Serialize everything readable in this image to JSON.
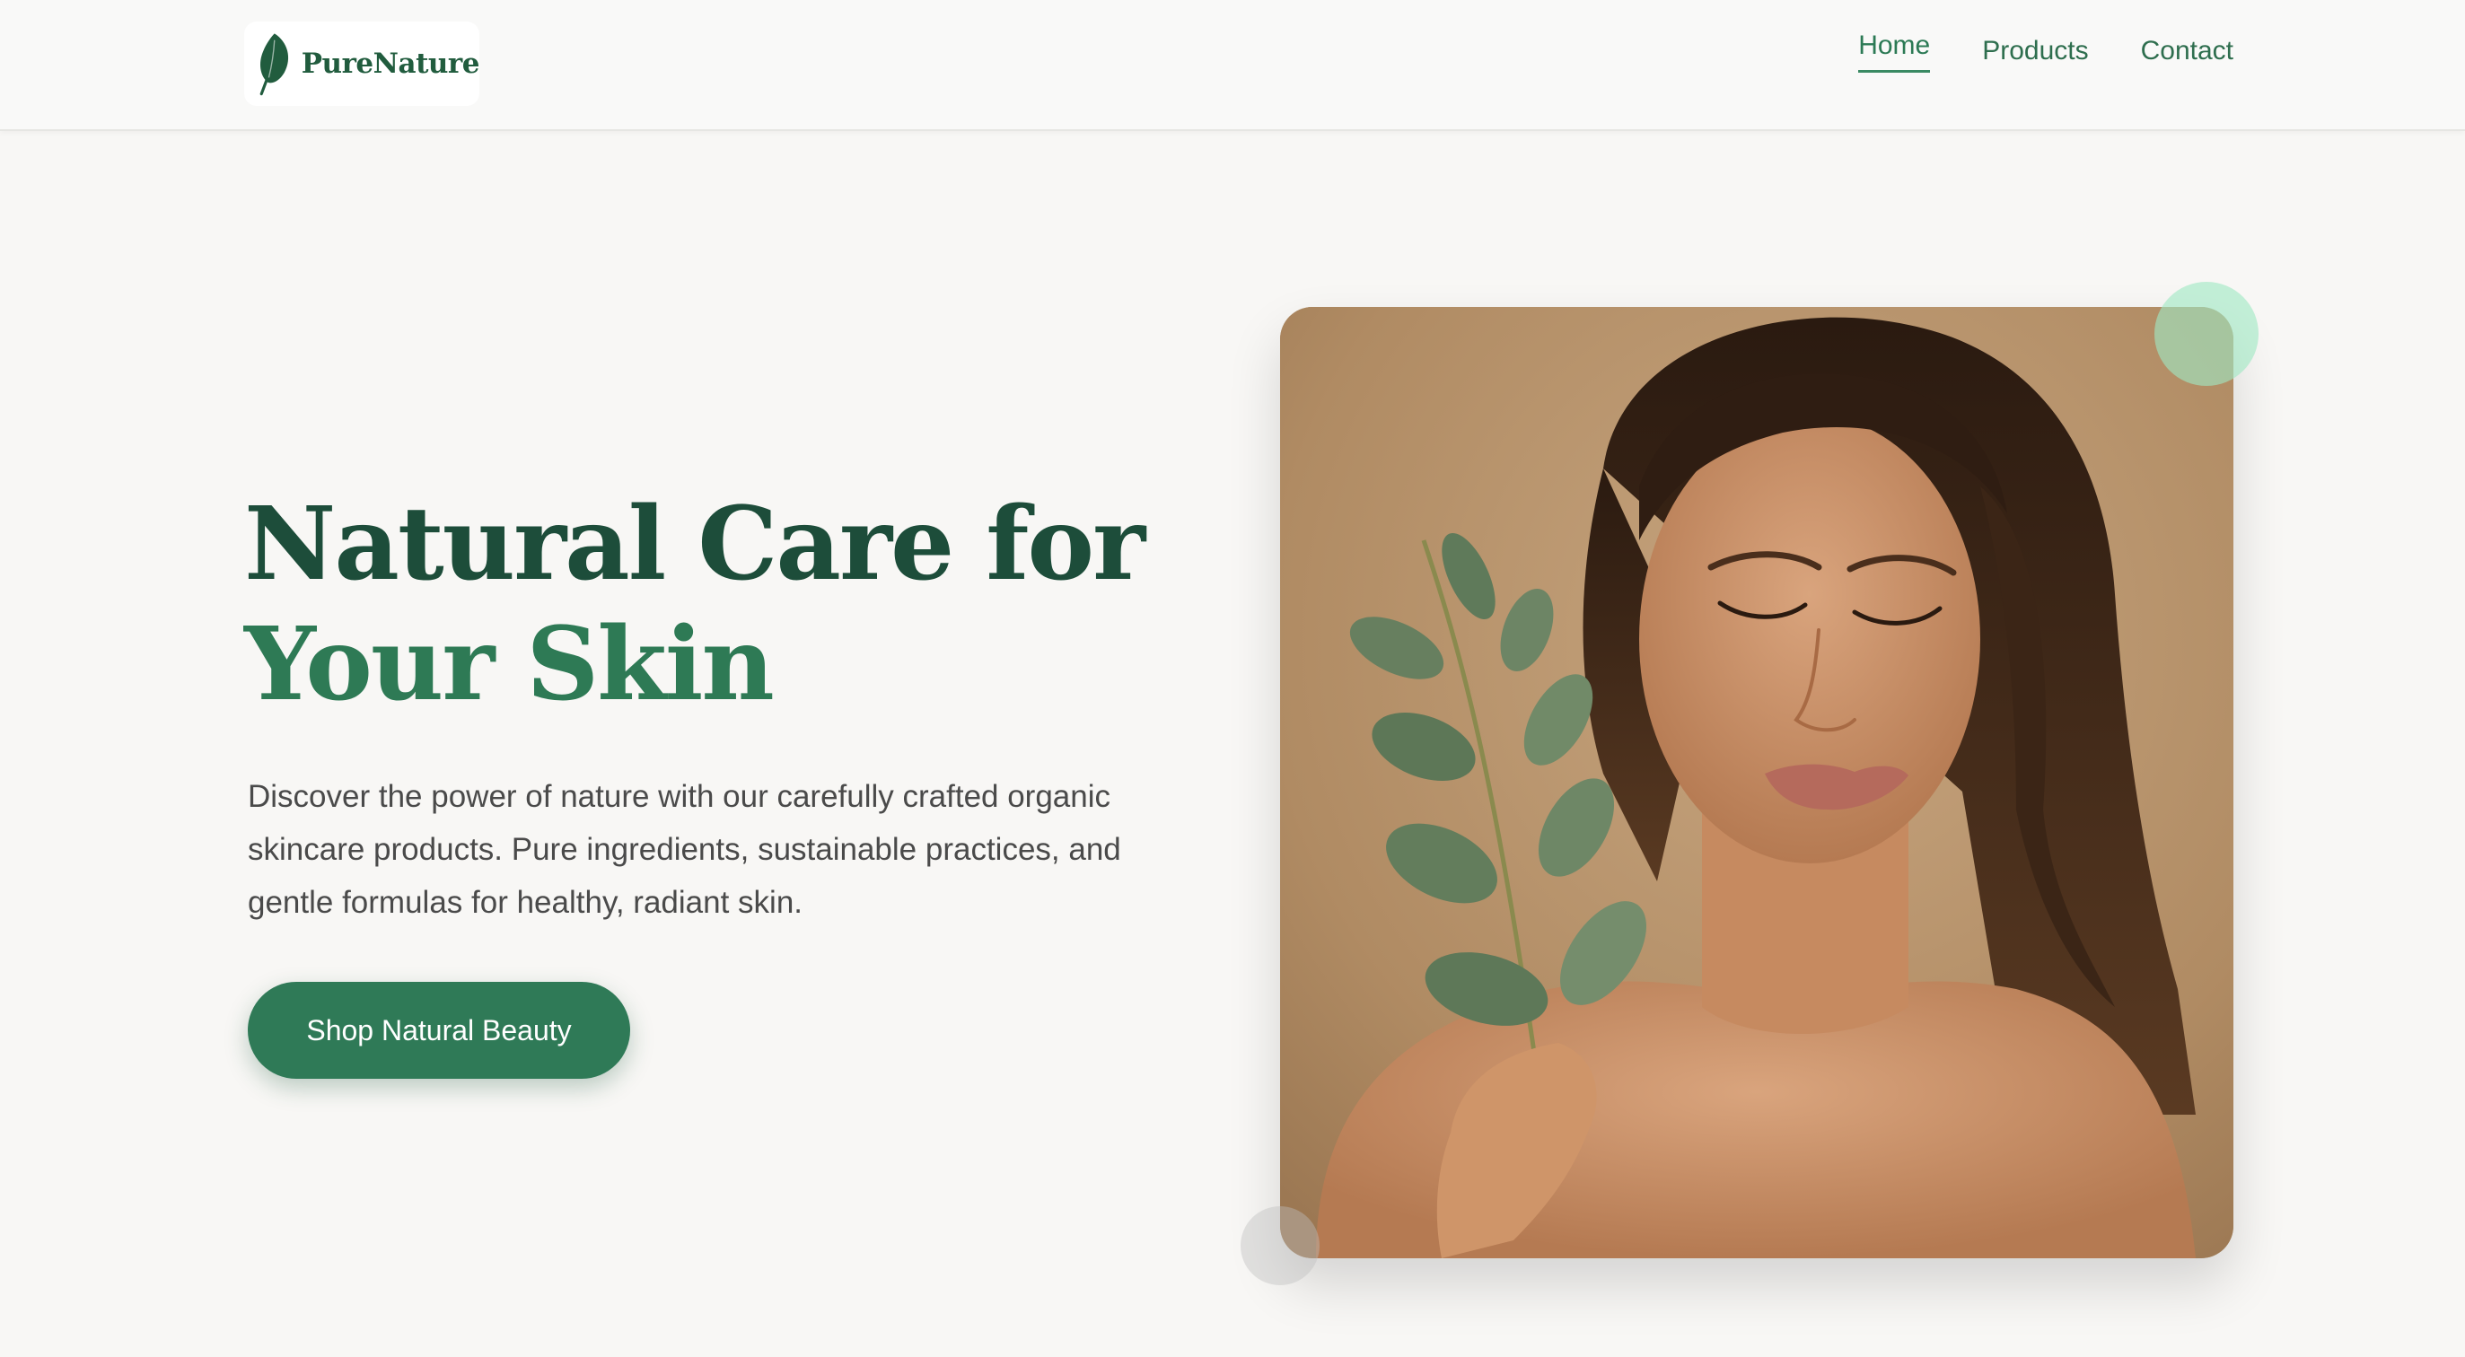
{
  "brand": {
    "name": "PureNature",
    "color": "#215c3e"
  },
  "nav": {
    "items": [
      {
        "label": "Home",
        "active": true
      },
      {
        "label": "Products",
        "active": false
      },
      {
        "label": "Contact",
        "active": false
      }
    ]
  },
  "hero": {
    "title_line1": "Natural Care for",
    "title_line2": "Your Skin",
    "description": "Discover the power of nature with our carefully crafted organic skincare products. Pure ingredients, sustainable practices, and gentle formulas for healthy, radiant skin.",
    "cta_label": "Shop Natural Beauty"
  },
  "icons": {
    "logo": "leaf-icon"
  },
  "colors": {
    "primary": "#2f7a57",
    "title_dark": "#1d4d3a",
    "title_accent": "#2e7a55",
    "background": "#f8f7f5",
    "accent_circle": "#a0e8c4"
  }
}
